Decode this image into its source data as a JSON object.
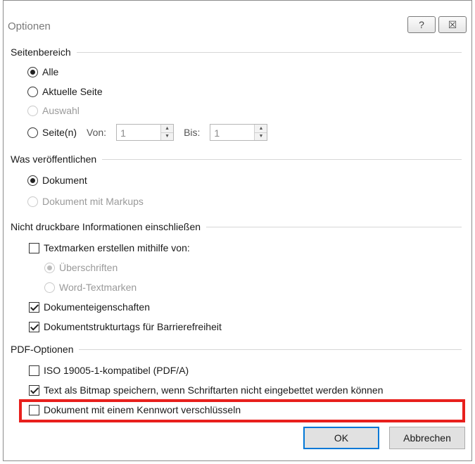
{
  "window": {
    "title": "Optionen",
    "help_glyph": "?",
    "close_glyph": "☒"
  },
  "groups": {
    "seitenbereich": "Seitenbereich",
    "veroeffentlichen": "Was veröffentlichen",
    "nicht_druckbar": "Nicht druckbare Informationen einschließen",
    "pdf_optionen": "PDF-Optionen"
  },
  "seitenbereich": {
    "alle": "Alle",
    "aktuelle_seite": "Aktuelle Seite",
    "auswahl": "Auswahl",
    "seiten": "Seite(n)",
    "von_label": "Von:",
    "von_value": "1",
    "bis_label": "Bis:",
    "bis_value": "1"
  },
  "veroeffentlichen": {
    "dokument": "Dokument",
    "dokument_markups": "Dokument mit Markups"
  },
  "nicht_druckbar": {
    "textmarken": "Textmarken erstellen mithilfe von:",
    "ueberschriften": "Überschriften",
    "word_textmarken": "Word-Textmarken",
    "dokumenteigenschaften": "Dokumenteigenschaften",
    "strukturtags": "Dokumentstrukturtags für Barrierefreiheit"
  },
  "pdf_optionen": {
    "iso": "ISO 19005-1-kompatibel (PDF/A)",
    "bitmap": "Text als Bitmap speichern, wenn Schriftarten nicht eingebettet werden können",
    "kennwort": "Dokument mit einem Kennwort verschlüsseln"
  },
  "buttons": {
    "ok": "OK",
    "cancel": "Abbrechen"
  },
  "colors": {
    "highlight": "#e8201d",
    "default_button_border": "#0078d7"
  }
}
